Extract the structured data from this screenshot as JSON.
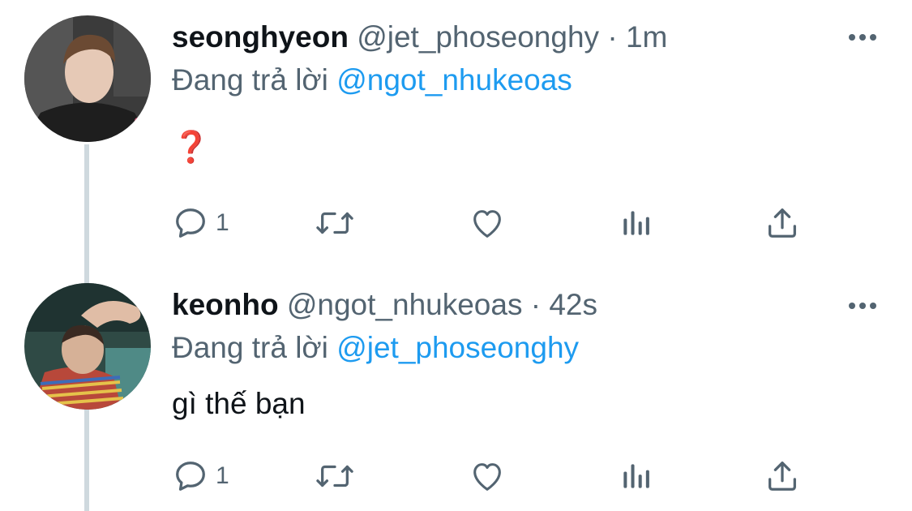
{
  "tweets": [
    {
      "name": "seonghyeon",
      "handle": "@jet_phoseonghy",
      "separator": "·",
      "time": "1m",
      "replying_prefix": "Đang trả lời",
      "replying_to": "@ngot_nhukeoas",
      "body": "❓",
      "reply_count": "1"
    },
    {
      "name": "keonho",
      "handle": "@ngot_nhukeoas",
      "separator": "·",
      "time": "42s",
      "replying_prefix": "Đang trả lời",
      "replying_to": "@jet_phoseonghy",
      "body": "gì thế bạn",
      "reply_count": "1"
    }
  ],
  "icons": {
    "more": "more-horizontal-icon",
    "reply": "reply-icon",
    "retweet": "retweet-icon",
    "like": "heart-icon",
    "views": "views-icon",
    "share": "share-icon"
  },
  "colors": {
    "text": "#0f1419",
    "secondary": "#536471",
    "mention": "#1d9bf0",
    "thread_line": "#cfd9de",
    "question_mark": "#dd2e44"
  }
}
